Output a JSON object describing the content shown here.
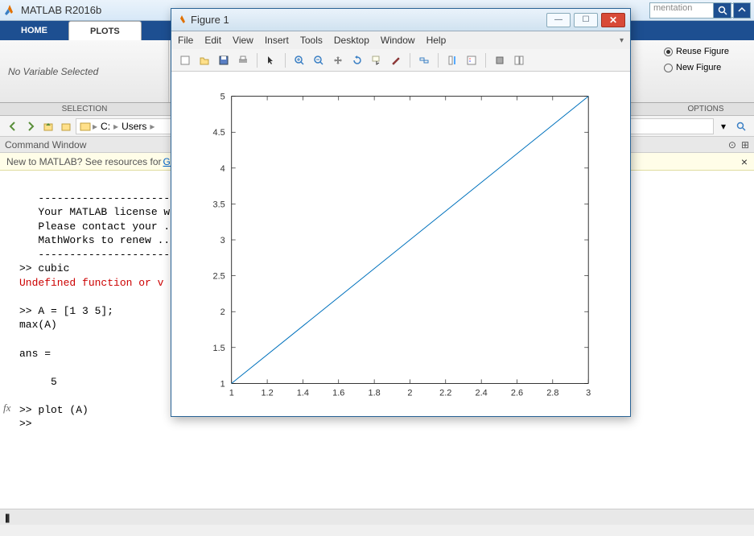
{
  "main_window": {
    "title": "MATLAB R2016b"
  },
  "tabs": {
    "home": "HOME",
    "plots": "PLOTS"
  },
  "search": {
    "placeholder": "mentation"
  },
  "ribbon": {
    "no_var": "No Variable Selected",
    "selection_label": "SELECTION",
    "options_label": "OPTIONS",
    "reuse_figure": "Reuse Figure",
    "new_figure": "New Figure"
  },
  "breadcrumb": {
    "drive": "C:",
    "p1": "Users"
  },
  "cmd": {
    "header": "Command Window",
    "banner_text": "New to MATLAB? See resources for ",
    "banner_link": "Ge",
    "lines": [
      "   -------------------------------------------------",
      "   Your MATLAB license will expire in ...",
      "   Please contact your ...",
      "   MathWorks to renew ...",
      "   -------------------------------------------------",
      ">> cubic",
      "Undefined function or v",
      "",
      ">> A = [1 3 5];",
      "max(A)",
      "",
      "ans =",
      "",
      "     5",
      "",
      ">> plot (A)",
      ">> "
    ]
  },
  "figure": {
    "title": "Figure 1",
    "menus": [
      "File",
      "Edit",
      "View",
      "Insert",
      "Tools",
      "Desktop",
      "Window",
      "Help"
    ]
  },
  "chart_data": {
    "type": "line",
    "x": [
      1,
      2,
      3
    ],
    "y": [
      1,
      3,
      5
    ],
    "xlim": [
      1,
      3
    ],
    "ylim": [
      1,
      5
    ],
    "xticks": [
      1,
      1.2,
      1.4,
      1.6,
      1.8,
      2,
      2.2,
      2.4,
      2.6,
      2.8,
      3
    ],
    "yticks": [
      1,
      1.5,
      2,
      2.5,
      3,
      3.5,
      4,
      4.5,
      5
    ],
    "title": "",
    "xlabel": "",
    "ylabel": ""
  }
}
